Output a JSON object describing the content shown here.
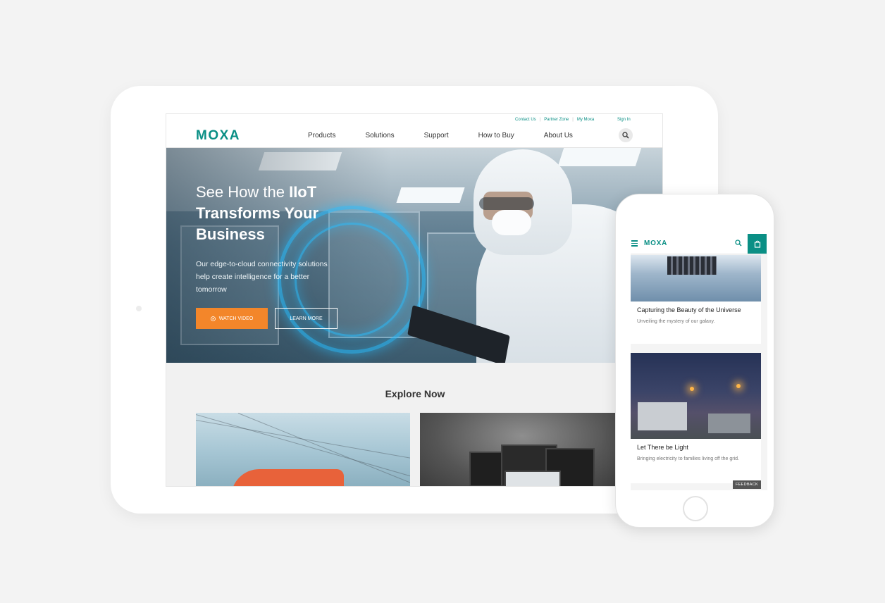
{
  "desktop": {
    "util_links": [
      "Contact Us",
      "Partner Zone",
      "My Moxa"
    ],
    "signin": "Sign In",
    "logo": "MOXA",
    "nav": [
      "Products",
      "Solutions",
      "Support",
      "How to Buy",
      "About Us"
    ],
    "hero": {
      "title_pre": "See How the ",
      "title_bold1": "IIoT",
      "title_bold2": "Transforms Your Business",
      "subtitle": "Our edge-to-cloud connectivity solutions help create intelligence for a better tomorrow",
      "watch_label": "WATCH VIDEO",
      "learn_label": "LEARN MORE"
    },
    "explore_title": "Explore Now"
  },
  "mobile": {
    "logo": "MOXA",
    "cards": [
      {
        "title": "Capturing the Beauty of the Universe",
        "desc": "Unveiling the mystery of our galaxy."
      },
      {
        "title": "Let There be Light",
        "desc": "Bringing electricity to families living off the grid."
      }
    ],
    "feedback": "FEEDBACK"
  },
  "colors": {
    "brand": "#0a8f85",
    "accent": "#f3862a"
  }
}
